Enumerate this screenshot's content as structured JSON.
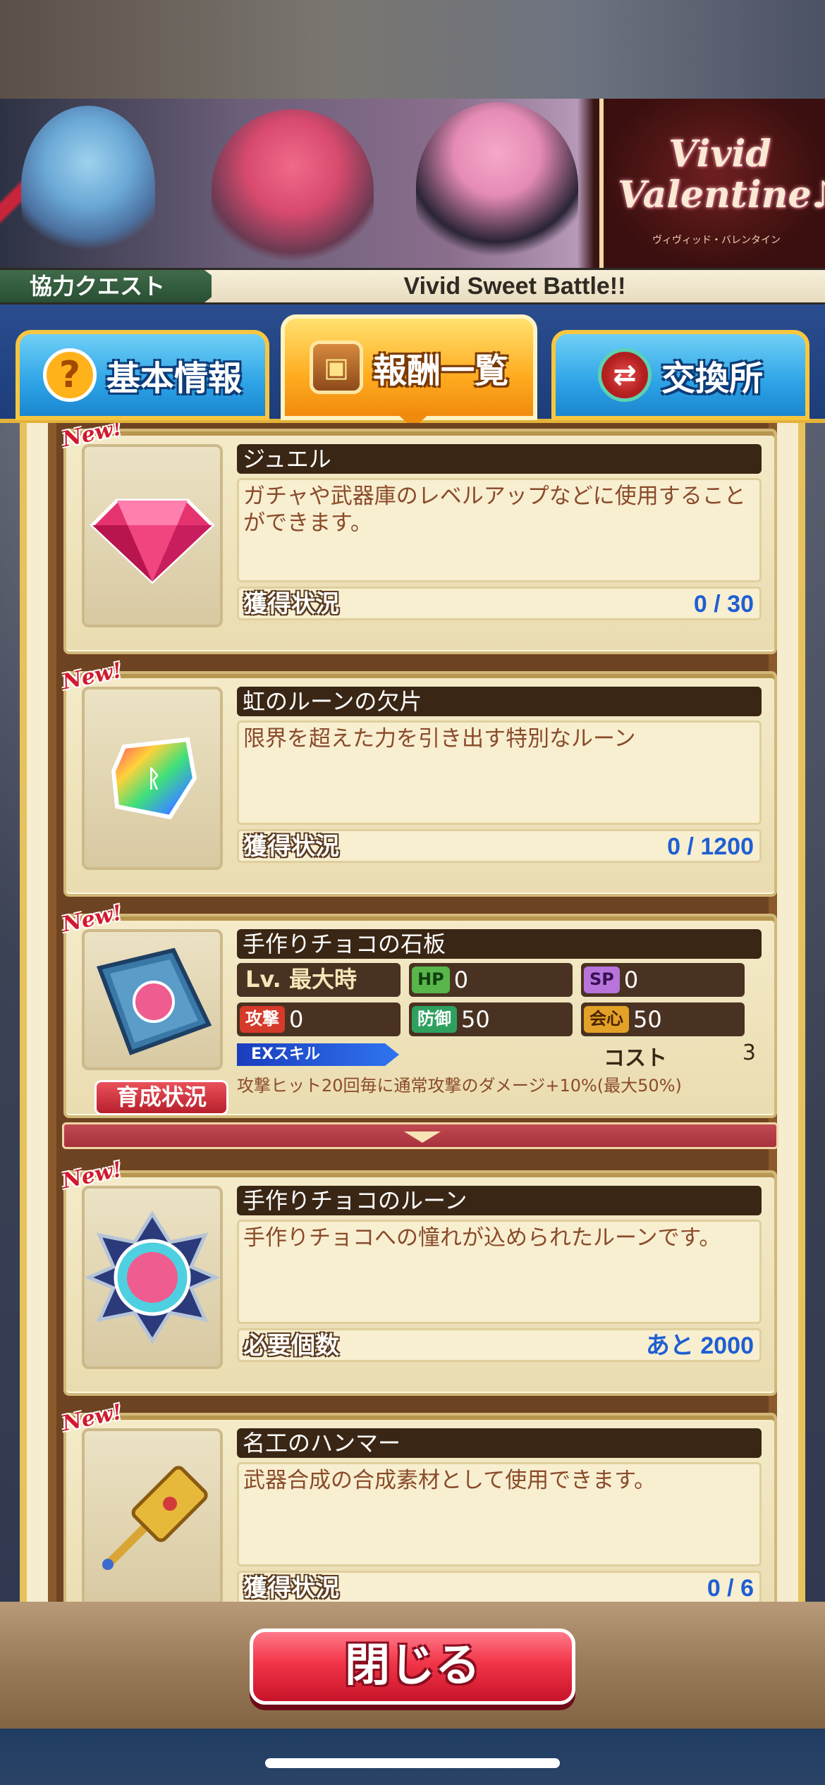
{
  "banner": {
    "logo_line1": "Vivid",
    "logo_line2": "Valentine♪",
    "logo_sub": "ヴィヴィッド・バレンタイン"
  },
  "quest": {
    "label": "協力クエスト",
    "title": "Vivid Sweet Battle!!"
  },
  "tabs": [
    {
      "label": "基本情報",
      "icon": "help-icon",
      "active": false
    },
    {
      "label": "報酬一覧",
      "icon": "treasure-chest-icon",
      "active": true
    },
    {
      "label": "交換所",
      "icon": "exchange-icon",
      "active": false
    }
  ],
  "new_badge": "New!",
  "rewards": [
    {
      "name": "ジュエル",
      "desc": "ガチャや武器庫のレベルアップなどに使用することができます。",
      "status_label": "獲得状況",
      "status_value": "0 / 30",
      "icon": "jewel-icon"
    },
    {
      "name": "虹のルーンの欠片",
      "desc": "限界を超えた力を引き出す特別なルーン",
      "status_label": "獲得状況",
      "status_value": "0 / 1200",
      "icon": "rainbow-rune-shard-icon"
    },
    {
      "name": "手作りチョコのルーン",
      "desc": "手作りチョコへの憧れが込められたルーンです。",
      "status_label": "必要個数",
      "status_value": "あと 2000",
      "icon": "chocolate-rune-icon"
    },
    {
      "name": "名工のハンマー",
      "desc": "武器合成の合成素材として使用できます。",
      "status_label": "獲得状況",
      "status_value": "0 / 6",
      "icon": "hammer-icon"
    }
  ],
  "unit_card": {
    "name": "手作りチョコの石板",
    "level": "Lv. 最大時",
    "hp_key": "HP",
    "hp": "0",
    "sp_key": "SP",
    "sp": "0",
    "atk_key": "攻撃",
    "atk": "0",
    "def_key": "防御",
    "def": "50",
    "crit_key": "会心",
    "crit": "50",
    "ex_skill": "EXスキル",
    "cost_label": "コスト",
    "cost": "3",
    "skill_desc": "攻撃ヒット20回毎に通常攻撃のダメージ+10%(最大50%)",
    "grow_button": "育成状況"
  },
  "footer": {
    "close_button": "閉じる"
  }
}
